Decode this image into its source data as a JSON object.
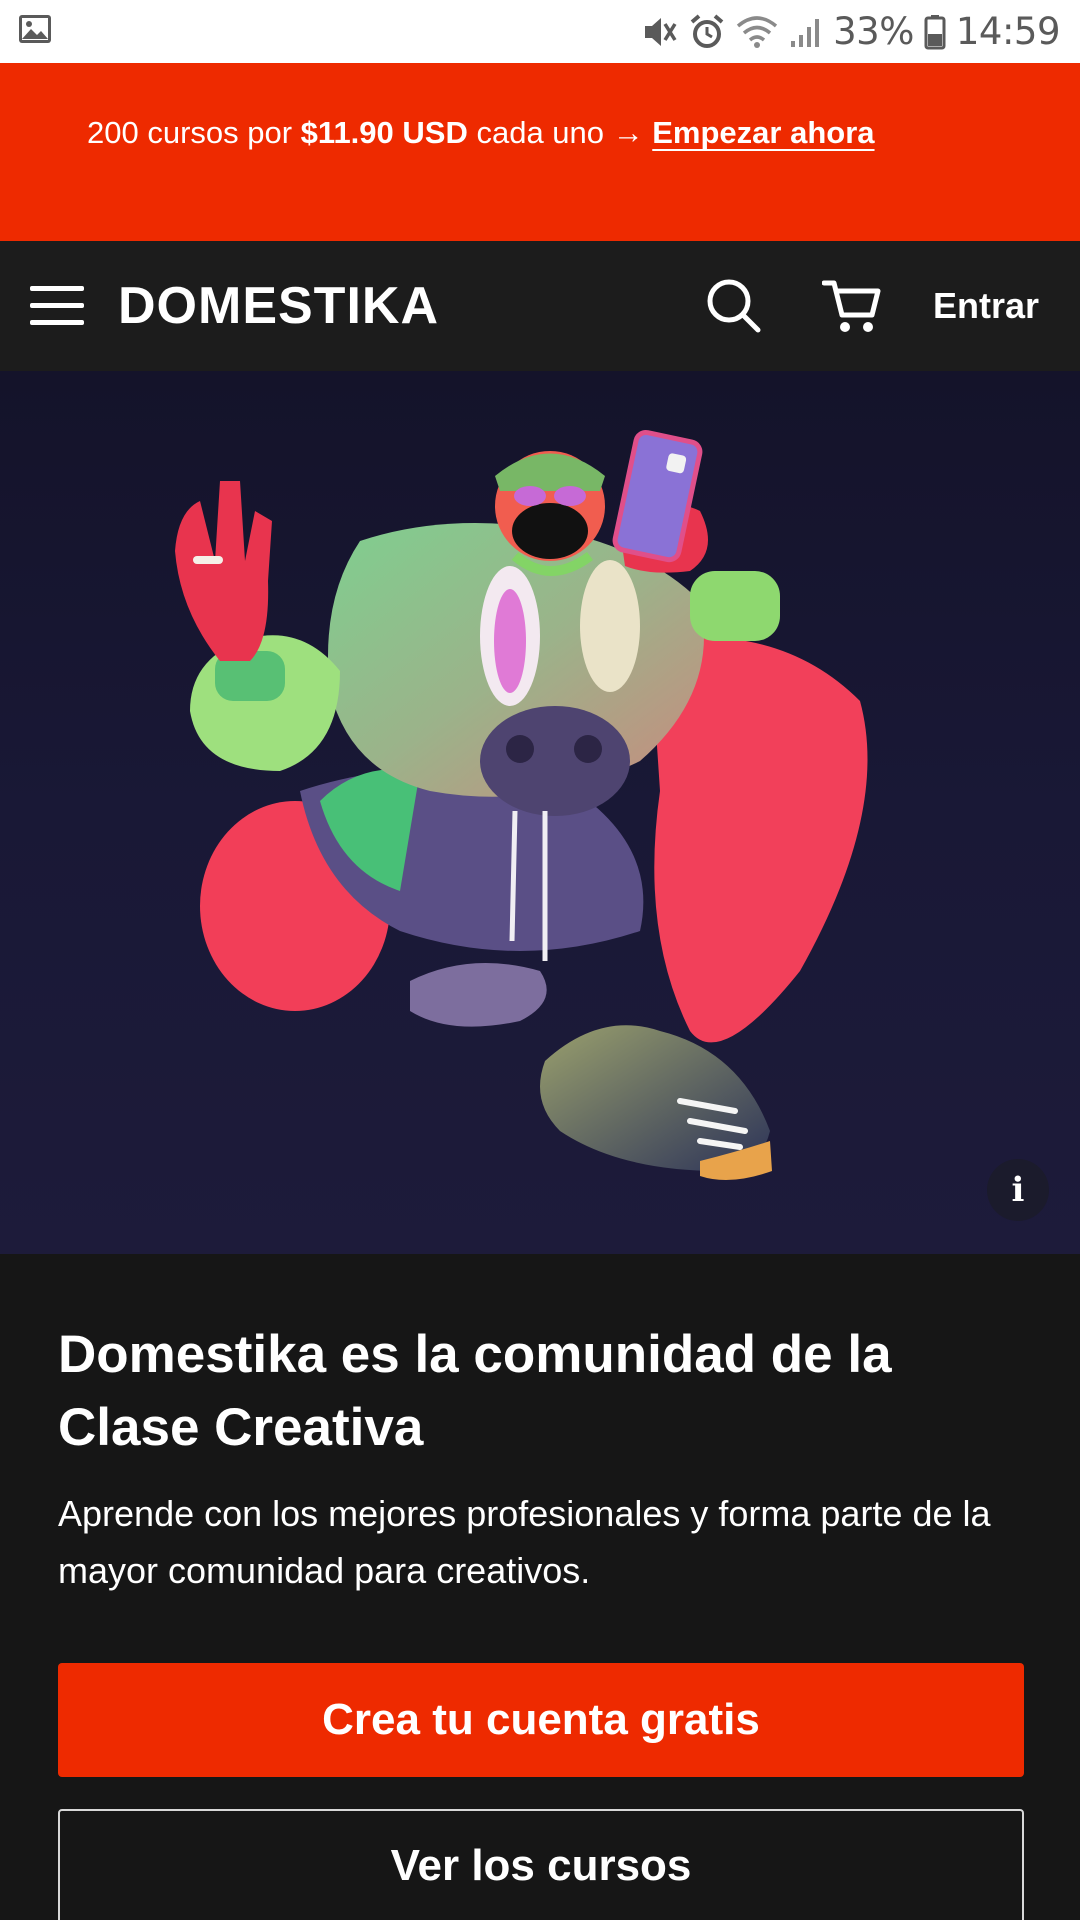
{
  "status_bar": {
    "battery": "33%",
    "time": "14:59",
    "icons": [
      "image-icon",
      "mute-icon",
      "alarm-icon",
      "wifi-icon",
      "signal-icon",
      "battery-icon"
    ]
  },
  "promo": {
    "prefix": "200 cursos por ",
    "price": "$11.90 USD",
    "middle": " cada uno → ",
    "cta": "Empezar ahora",
    "background": "#ee2a00"
  },
  "header": {
    "logo": "DOMESTIKA",
    "login_label": "Entrar",
    "icons": [
      "menu-icon",
      "search-icon",
      "cart-icon"
    ]
  },
  "hero": {
    "info_label": "i"
  },
  "content": {
    "headline": "Domestika es la comunidad de la Clase Creativa",
    "subline": "Aprende con los mejores profesionales y forma parte de la mayor comunidad para creativos.",
    "primary_button": "Crea tu cuenta gratis",
    "secondary_button": "Ver los cursos"
  },
  "colors": {
    "accent": "#ee2a00",
    "header_bg": "#1c1c1c",
    "page_bg": "#161616"
  }
}
